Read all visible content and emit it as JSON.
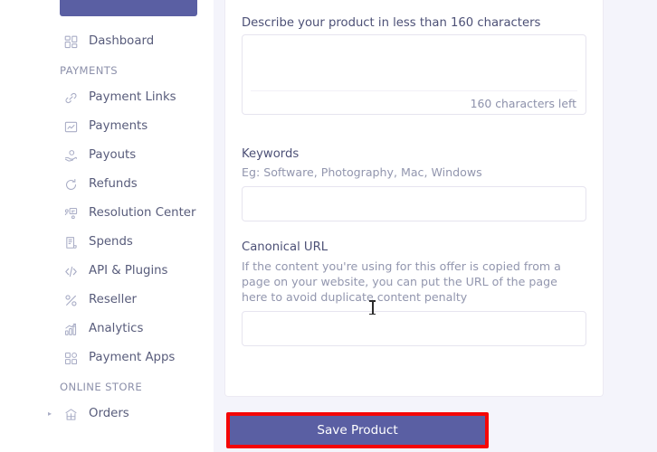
{
  "sidebar": {
    "cta_label": "",
    "top_items": [
      {
        "label": "Dashboard",
        "icon": "grid-icon"
      }
    ],
    "sections": [
      {
        "title": "PAYMENTS",
        "items": [
          {
            "label": "Payment Links",
            "icon": "link-icon"
          },
          {
            "label": "Payments",
            "icon": "chart-line-icon"
          },
          {
            "label": "Payouts",
            "icon": "hand-coin-icon"
          },
          {
            "label": "Refunds",
            "icon": "refund-arrow-icon"
          },
          {
            "label": "Resolution Center",
            "icon": "resolution-icon"
          },
          {
            "label": "Spends",
            "icon": "document-icon"
          },
          {
            "label": "API & Plugins",
            "icon": "code-icon"
          },
          {
            "label": "Reseller",
            "icon": "percent-icon"
          },
          {
            "label": "Analytics",
            "icon": "analytics-bar-icon"
          },
          {
            "label": "Payment Apps",
            "icon": "apps-grid-icon"
          }
        ]
      },
      {
        "title": "ONLINE STORE",
        "items": [
          {
            "label": "Orders",
            "icon": "store-icon",
            "caret": "▸"
          }
        ]
      }
    ]
  },
  "form": {
    "description": {
      "title": "Describe your product in less than 160 characters",
      "value": "",
      "counter": "160 characters left"
    },
    "keywords": {
      "title": "Keywords",
      "hint": "Eg: Software, Photography, Mac, Windows",
      "value": ""
    },
    "canonical_url": {
      "title": "Canonical URL",
      "hint": "If the content you're using for this offer is copied from a page on your website, you can put the URL of the page here to avoid duplicate content penalty",
      "value": ""
    }
  },
  "actions": {
    "save_label": "Save Product"
  },
  "colors": {
    "accent": "#5a5fa3",
    "highlight": "#f40606",
    "page_bg": "#f4f4fb",
    "card_bg": "#ffffff",
    "label": "#4c5076",
    "hint": "#9296ae"
  }
}
